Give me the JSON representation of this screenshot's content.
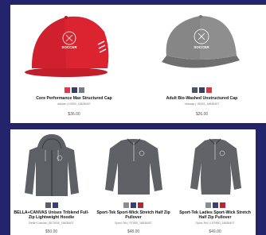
{
  "products": [
    {
      "name": "Core Performance Max Structured Cap",
      "sub": "adidas | 10593_16636407",
      "price": "$36.00",
      "swatches": [
        "#e53546",
        "#3a3f5c",
        "#777c82"
      ]
    },
    {
      "name": "Adult Bio-Washed Unstructured Cap",
      "sub": "Valucap | 26093_16636407",
      "price": "$26.00",
      "swatches": [
        "#4f5560",
        "#3a3f5c",
        "#d83a4c"
      ]
    },
    {
      "name": "BELLA+CANVAS Unisex Triblend Full-Zip Lightweight Hoodie",
      "sub": "Bella+Canvas | BC3939_16636407",
      "price": "$50.00",
      "swatches": [
        "#5c6066",
        "#3a3f72"
      ]
    },
    {
      "name": "Sport-Tek Sport-Wick Stretch Half Zip Pullover",
      "sub": "Sport-Tek | ST850_16636407",
      "price": "$48.00",
      "swatches": [
        "#8a8e94",
        "#3a3f72",
        "#b8262f"
      ]
    },
    {
      "name": "Sport-Tek Ladies Sport-Wick Stretch Half Zip Pullover",
      "sub": "Sport-Tek | LST850_16636407",
      "price": "$49.00",
      "swatches": [
        "#8a8e94",
        "#3a3f72",
        "#b8262f"
      ]
    }
  ],
  "logo_text": "SOCCER"
}
